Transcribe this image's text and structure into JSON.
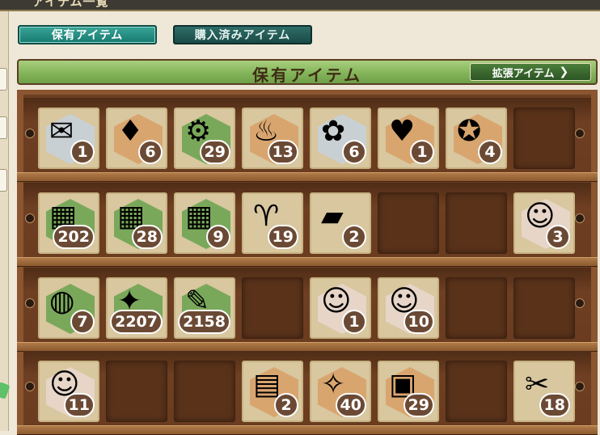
{
  "window": {
    "title": "アイテム一覧"
  },
  "tabs": [
    {
      "label": "保有アイテム",
      "active": true
    },
    {
      "label": "購入済みアイテム",
      "active": false
    }
  ],
  "banner": {
    "title": "保有アイテム",
    "extension_button": "拡張アイテム"
  },
  "colors": {
    "accent": "#177a70",
    "banner": "#84b45a",
    "shelf": "#6b3f22",
    "badge": "#6b4a35"
  },
  "shelf": {
    "rows": [
      {
        "items": [
          {
            "name": "document-envelope-icon",
            "glyph": "✉",
            "hex": "#c9d0d4",
            "count": "1"
          },
          {
            "name": "red-chest-icon",
            "glyph": "♦",
            "hex": "#d9a56f",
            "count": "6"
          },
          {
            "name": "screw-icon",
            "glyph": "⚙",
            "hex": "#7aa85a",
            "count": "29"
          },
          {
            "name": "shell-icon",
            "glyph": "♨",
            "hex": "#d9a56f",
            "count": "13"
          },
          {
            "name": "gift-box-icon",
            "glyph": "✿",
            "hex": "#c9d0d4",
            "count": "6"
          },
          {
            "name": "red-bag-icon",
            "glyph": "♥",
            "hex": "#d9a56f",
            "count": "1"
          },
          {
            "name": "medal-icon",
            "glyph": "✪",
            "hex": "#d9a56f",
            "count": "4"
          },
          {
            "name": "empty",
            "empty": true
          }
        ]
      },
      {
        "items": [
          {
            "name": "wooden-box-icon",
            "glyph": "▦",
            "hex": "#7aa85a",
            "count": "202"
          },
          {
            "name": "dark-box-icon",
            "glyph": "▦",
            "hex": "#7aa85a",
            "count": "28"
          },
          {
            "name": "red-box-icon",
            "glyph": "▦",
            "hex": "#7aa85a",
            "count": "9"
          },
          {
            "name": "goblet-icon",
            "glyph": "♈",
            "hex": "#d8c79f",
            "count": "19"
          },
          {
            "name": "plank-icon",
            "glyph": "▰",
            "hex": "#d8c79f",
            "count": "2"
          },
          {
            "name": "empty",
            "empty": true
          },
          {
            "name": "empty",
            "empty": true
          },
          {
            "name": "repair-girl-icon",
            "glyph": "☺",
            "hex": "#e7d5c8",
            "count": "3"
          }
        ]
      },
      {
        "items": [
          {
            "name": "repair-bucket-icon",
            "glyph": "◍",
            "hex": "#7aa85a",
            "count": "7"
          },
          {
            "name": "burner-icon",
            "glyph": "✦",
            "hex": "#7aa85a",
            "count": "2207"
          },
          {
            "name": "development-material-icon",
            "glyph": "✎",
            "hex": "#7aa85a",
            "count": "2158"
          },
          {
            "name": "empty",
            "empty": true
          },
          {
            "name": "fairy-helmet-icon",
            "glyph": "☺",
            "hex": "#e7d5c8",
            "count": "1"
          },
          {
            "name": "fairy-halo-icon",
            "glyph": "☺",
            "hex": "#e7d5c8",
            "count": "10"
          },
          {
            "name": "empty",
            "empty": true
          },
          {
            "name": "empty",
            "empty": true
          }
        ]
      },
      {
        "items": [
          {
            "name": "pilot-fairy-icon",
            "glyph": "☺",
            "hex": "#e7d5c8",
            "count": "11"
          },
          {
            "name": "empty",
            "empty": true
          },
          {
            "name": "empty",
            "empty": true
          },
          {
            "name": "lantern-icon",
            "glyph": "▤",
            "hex": "#d9a56f",
            "count": "2"
          },
          {
            "name": "seashell-icon",
            "glyph": "✧",
            "hex": "#d9a56f",
            "count": "40"
          },
          {
            "name": "can-icon",
            "glyph": "▣",
            "hex": "#d9a56f",
            "count": "29"
          },
          {
            "name": "empty",
            "empty": true
          },
          {
            "name": "tools-icon",
            "glyph": "✂",
            "hex": "#d8c79f",
            "count": "18"
          }
        ]
      }
    ]
  }
}
